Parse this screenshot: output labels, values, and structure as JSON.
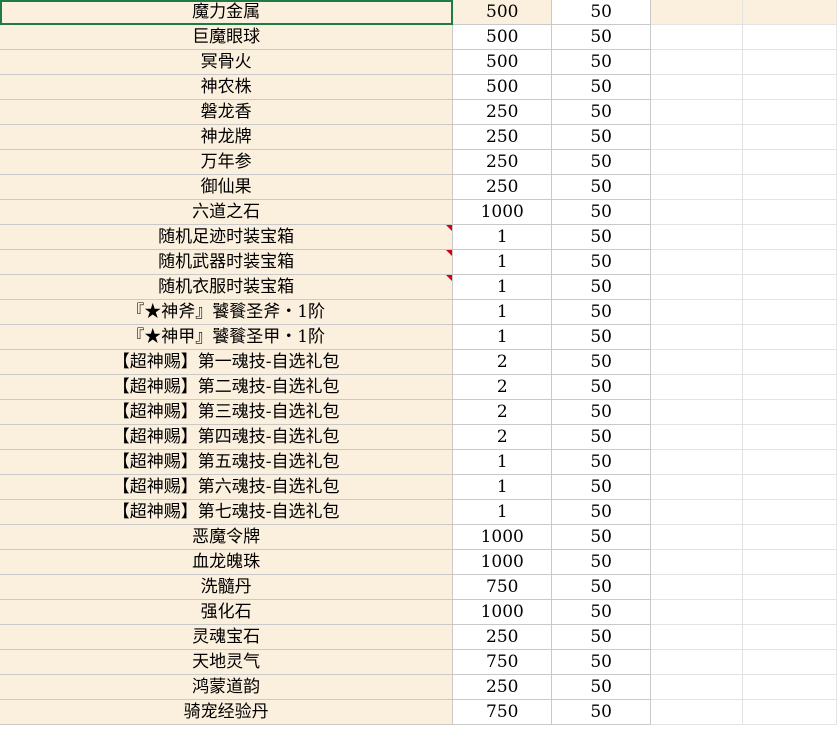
{
  "rows": [
    {
      "name": "魔力金属",
      "qty": "500",
      "limit": "50"
    },
    {
      "name": "巨魔眼球",
      "qty": "500",
      "limit": "50"
    },
    {
      "name": "冥骨火",
      "qty": "500",
      "limit": "50"
    },
    {
      "name": "神农株",
      "qty": "500",
      "limit": "50"
    },
    {
      "name": "磐龙香",
      "qty": "250",
      "limit": "50"
    },
    {
      "name": "神龙牌",
      "qty": "250",
      "limit": "50"
    },
    {
      "name": "万年参",
      "qty": "250",
      "limit": "50"
    },
    {
      "name": "御仙果",
      "qty": "250",
      "limit": "50"
    },
    {
      "name": "六道之石",
      "qty": "1000",
      "limit": "50"
    },
    {
      "name": "随机足迹时装宝箱",
      "qty": "1",
      "limit": "50"
    },
    {
      "name": "随机武器时装宝箱",
      "qty": "1",
      "limit": "50"
    },
    {
      "name": "随机衣服时装宝箱",
      "qty": "1",
      "limit": "50"
    },
    {
      "name": "『★神斧』饕餮圣斧・1阶",
      "qty": "1",
      "limit": "50"
    },
    {
      "name": "『★神甲』饕餮圣甲・1阶",
      "qty": "1",
      "limit": "50"
    },
    {
      "name": "【超神赐】第一魂技-自选礼包",
      "qty": "2",
      "limit": "50"
    },
    {
      "name": "【超神赐】第二魂技-自选礼包",
      "qty": "2",
      "limit": "50"
    },
    {
      "name": "【超神赐】第三魂技-自选礼包",
      "qty": "2",
      "limit": "50"
    },
    {
      "name": "【超神赐】第四魂技-自选礼包",
      "qty": "2",
      "limit": "50"
    },
    {
      "name": "【超神赐】第五魂技-自选礼包",
      "qty": "1",
      "limit": "50"
    },
    {
      "name": "【超神赐】第六魂技-自选礼包",
      "qty": "1",
      "limit": "50"
    },
    {
      "name": "【超神赐】第七魂技-自选礼包",
      "qty": "1",
      "limit": "50"
    },
    {
      "name": "恶魔令牌",
      "qty": "1000",
      "limit": "50"
    },
    {
      "name": "血龙魄珠",
      "qty": "1000",
      "limit": "50"
    },
    {
      "name": "洗髓丹",
      "qty": "750",
      "limit": "50"
    },
    {
      "name": "强化石",
      "qty": "1000",
      "limit": "50"
    },
    {
      "name": "灵魂宝石",
      "qty": "250",
      "limit": "50"
    },
    {
      "name": "天地灵气",
      "qty": "750",
      "limit": "50"
    },
    {
      "name": "鸿蒙道韵",
      "qty": "250",
      "limit": "50"
    },
    {
      "name": "骑宠经验丹",
      "qty": "750",
      "limit": "50"
    }
  ],
  "comment_rows": [
    9,
    10,
    11
  ],
  "colors": {
    "name_fill": "#fbefdd",
    "selection": "#1e7b45",
    "comment_marker": "#d0021b",
    "gridline": "#c9c9c9"
  }
}
